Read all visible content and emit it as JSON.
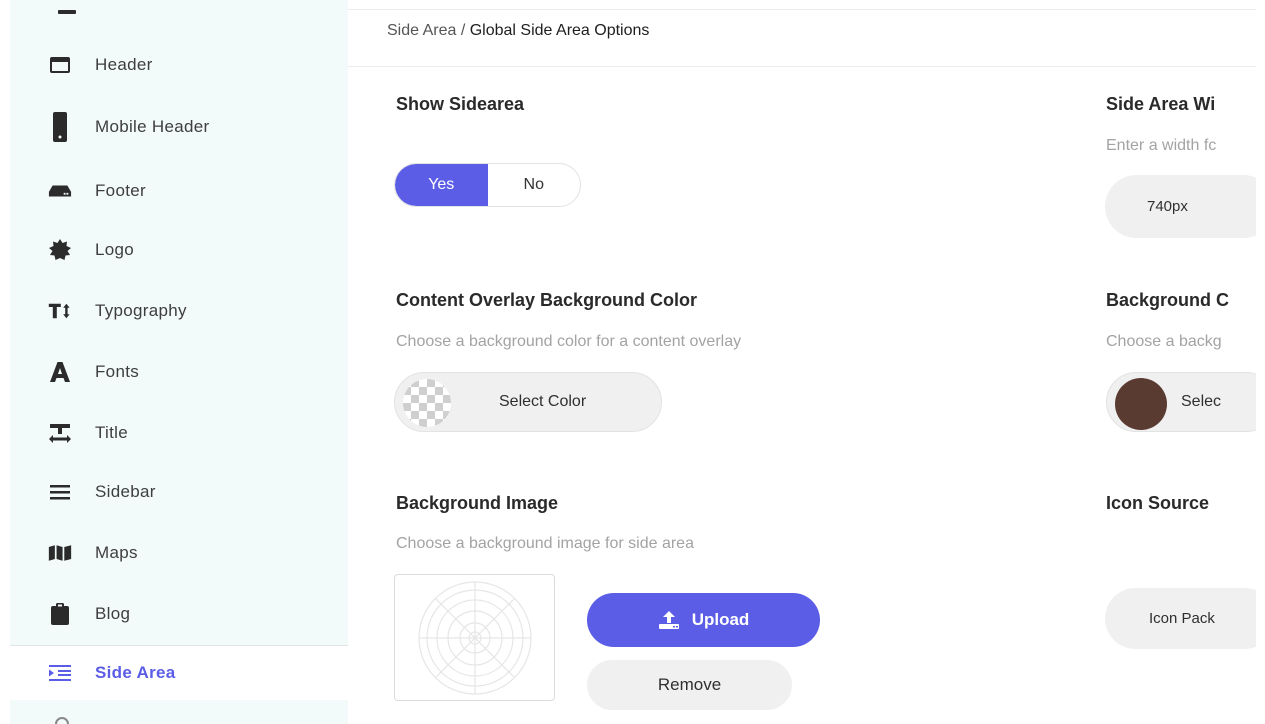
{
  "sidebar": {
    "items": [
      {
        "label": "Header",
        "icon": "header-icon"
      },
      {
        "label": "Mobile Header",
        "icon": "mobile-icon"
      },
      {
        "label": "Footer",
        "icon": "footer-icon"
      },
      {
        "label": "Logo",
        "icon": "logo-icon"
      },
      {
        "label": "Typography",
        "icon": "typography-icon"
      },
      {
        "label": "Fonts",
        "icon": "fonts-icon"
      },
      {
        "label": "Title",
        "icon": "title-icon"
      },
      {
        "label": "Sidebar",
        "icon": "sidebar-lines-icon"
      },
      {
        "label": "Maps",
        "icon": "map-icon"
      },
      {
        "label": "Blog",
        "icon": "clipboard-icon"
      },
      {
        "label": "Side Area",
        "icon": "indent-icon",
        "active": true
      }
    ]
  },
  "breadcrumb": {
    "parent": "Side Area",
    "separator": " / ",
    "current": "Global Side Area Options"
  },
  "options": {
    "show_sidearea": {
      "title": "Show Sidearea",
      "yes_label": "Yes",
      "no_label": "No",
      "selected": "Yes"
    },
    "side_area_width": {
      "title": "Side Area Wi",
      "description": "Enter a width fc",
      "value": "740px"
    },
    "content_overlay_bg": {
      "title": "Content Overlay Background Color",
      "description": "Choose a background color for a content overlay",
      "button_label": "Select Color",
      "color": "transparent"
    },
    "background_color": {
      "title": "Background C",
      "description": "Choose a backg",
      "button_label": "Selec",
      "color": "#5a3b31"
    },
    "background_image": {
      "title": "Background Image",
      "description": "Choose a background image for side area",
      "upload_label": "Upload",
      "remove_label": "Remove"
    },
    "icon_source": {
      "title": "Icon Source",
      "value": "Icon Pack"
    }
  },
  "colors": {
    "accent": "#5b5de6",
    "sidebar_bg": "#f3fafa"
  }
}
